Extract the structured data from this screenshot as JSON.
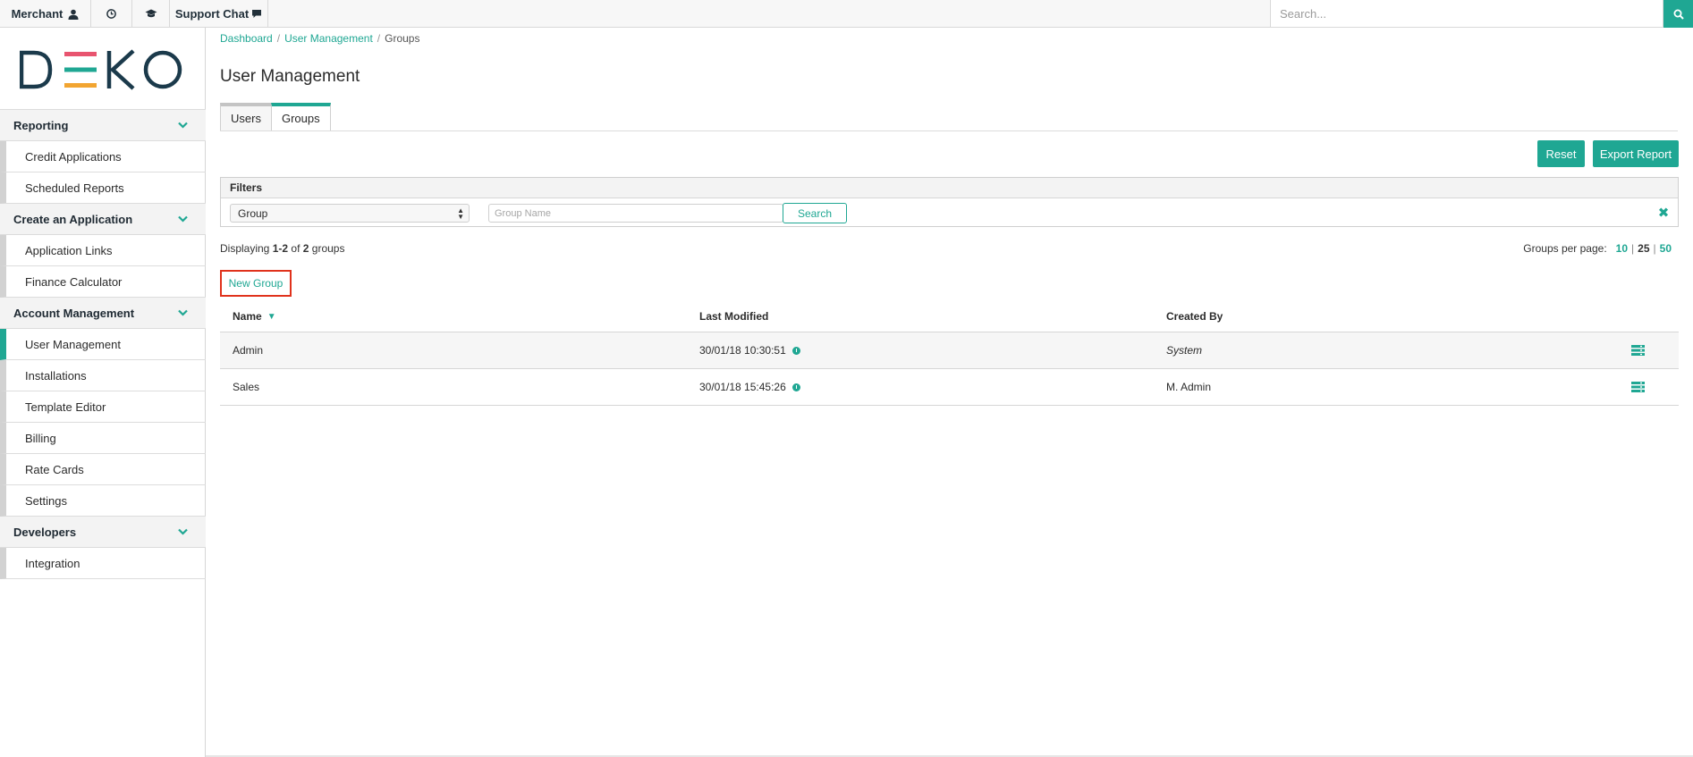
{
  "topbar": {
    "merchant_label": "Merchant",
    "support_chat_label": "Support Chat",
    "search_placeholder": "Search..."
  },
  "brand": {
    "logo_text": "DEKO"
  },
  "sidebar": {
    "groups": [
      {
        "label": "Reporting",
        "items": [
          "Credit Applications",
          "Scheduled Reports"
        ]
      },
      {
        "label": "Create an Application",
        "items": [
          "Application Links",
          "Finance Calculator"
        ]
      },
      {
        "label": "Account Management",
        "items": [
          "User Management",
          "Installations",
          "Template Editor",
          "Billing",
          "Rate Cards",
          "Settings"
        ]
      },
      {
        "label": "Developers",
        "items": [
          "Integration"
        ]
      }
    ],
    "active_item": "User Management"
  },
  "breadcrumb": {
    "items": [
      "Dashboard",
      "User Management",
      "Groups"
    ],
    "separator": "/"
  },
  "page": {
    "title": "User Management"
  },
  "tabs": [
    {
      "label": "Users"
    },
    {
      "label": "Groups",
      "active": true
    }
  ],
  "toolbar": {
    "reset_label": "Reset",
    "export_label": "Export Report"
  },
  "filters": {
    "title": "Filters",
    "select_value": "Group",
    "input_placeholder": "Group Name",
    "search_label": "Search"
  },
  "summary": {
    "prefix": "Displaying",
    "range": "1-2",
    "of": "of",
    "total": "2",
    "suffix": "groups"
  },
  "per_page": {
    "label": "Groups per page:",
    "options": [
      "10",
      "25",
      "50"
    ],
    "current": "25"
  },
  "actions": {
    "new_group_label": "New Group"
  },
  "table": {
    "columns": [
      "Name",
      "Last Modified",
      "Created By"
    ],
    "rows": [
      {
        "name": "Admin",
        "last_modified": "30/01/18 10:30:51",
        "created_by": "System"
      },
      {
        "name": "Sales",
        "last_modified": "30/01/18 15:45:26",
        "created_by": "M. Admin"
      }
    ]
  },
  "colors": {
    "accent": "#1fa793",
    "highlight_border": "#e0321c",
    "logo_red": "#e8546f",
    "logo_teal": "#1fa793",
    "logo_yellow": "#f2a531",
    "logo_dark": "#1b3a4b"
  },
  "icons": [
    "user-icon",
    "clock-icon",
    "graduation-cap-icon",
    "chat-bubble-icon",
    "search-icon",
    "chevron-down-icon",
    "close-icon",
    "info-icon",
    "row-menu-icon",
    "sort-down-icon"
  ]
}
